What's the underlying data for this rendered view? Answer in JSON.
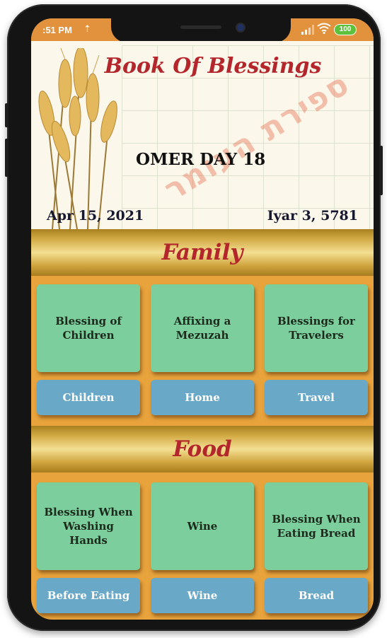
{
  "status_bar": {
    "time": ":51 PM",
    "upload_icon": "upload-arrow-icon",
    "battery": "100"
  },
  "banner": {
    "title": "Book Of Blessings",
    "omer_day": "OMER DAY 18",
    "gregorian_date": "Apr 15, 2021",
    "hebrew_date": "Iyar 3, 5781",
    "hebrew_stamp": "ספירת העומר"
  },
  "sections": [
    {
      "title": "Family",
      "cards": [
        "Blessing of Children",
        "Affixing a Mezuzah",
        "Blessings for Travelers"
      ],
      "buttons": [
        "Children",
        "Home",
        "Travel"
      ]
    },
    {
      "title": "Food",
      "cards": [
        "Blessing When Washing Hands",
        "Wine",
        "Blessing When Eating Bread"
      ],
      "buttons": [
        "Before Eating",
        "Wine",
        "Bread"
      ]
    }
  ],
  "colors": {
    "title_red": "#b3262b",
    "card_green": "#7ccf9d",
    "button_blue": "#6aa8c7",
    "background_orange": "#e8a33c",
    "status_battery": "#5ec13b"
  }
}
